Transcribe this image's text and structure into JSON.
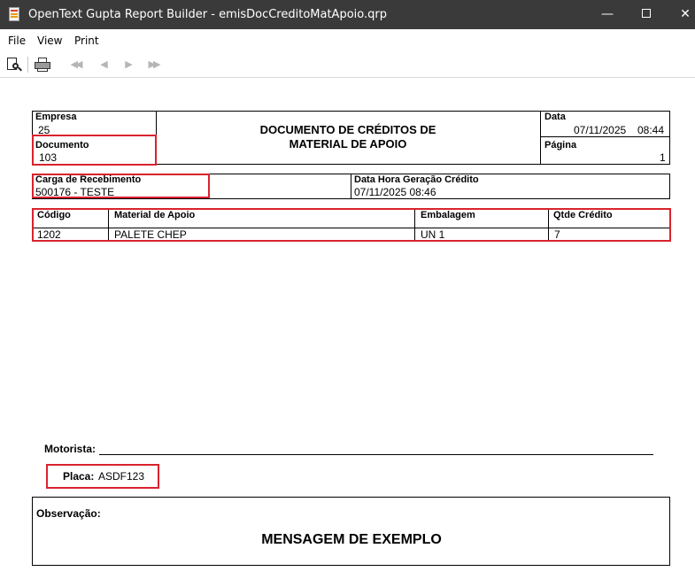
{
  "window": {
    "title": "OpenText Gupta Report Builder - emisDocCreditoMatApoio.qrp",
    "minimize": "—",
    "close": "✕"
  },
  "menu": {
    "items": [
      "File",
      "View",
      "Print"
    ]
  },
  "toolbar": {
    "icons": [
      "print-preview-icon",
      "print-icon",
      "first-page-icon",
      "previous-page-icon",
      "next-page-icon",
      "last-page-icon"
    ],
    "first": "◀◀",
    "prev": "◀",
    "next": "▶",
    "last": "▶▶"
  },
  "colors": {
    "titlebar": "#3a3a3a",
    "highlight": "#d9232d"
  },
  "report": {
    "header": {
      "empresa_label": "Empresa",
      "empresa_value": "25",
      "documento_label": "Documento",
      "documento_value": "103",
      "title_line1": "DOCUMENTO DE CRÉDITOS DE",
      "title_line2": "MATERIAL DE APOIO",
      "data_label": "Data",
      "data_value": "07/11/2025",
      "hora_value": "08:44",
      "pagina_label": "Página",
      "pagina_value": "1"
    },
    "carga": {
      "label": "Carga de Recebimento",
      "value": "500176 - TESTE",
      "data_hora_label": "Data Hora Geração Crédito",
      "data_hora_value": "07/11/2025 08:46"
    },
    "table": {
      "headers": [
        "Código",
        "Material de Apoio",
        "Embalagem",
        "Qtde Crédito"
      ],
      "rows": [
        [
          "1202",
          "PALETE CHEP",
          "UN 1",
          "7"
        ]
      ]
    },
    "motorista_label": "Motorista:",
    "placa_label": "Placa:",
    "placa_value": "ASDF123",
    "observacao_label": "Observação:",
    "mensagem": "MENSAGEM DE EXEMPLO"
  }
}
